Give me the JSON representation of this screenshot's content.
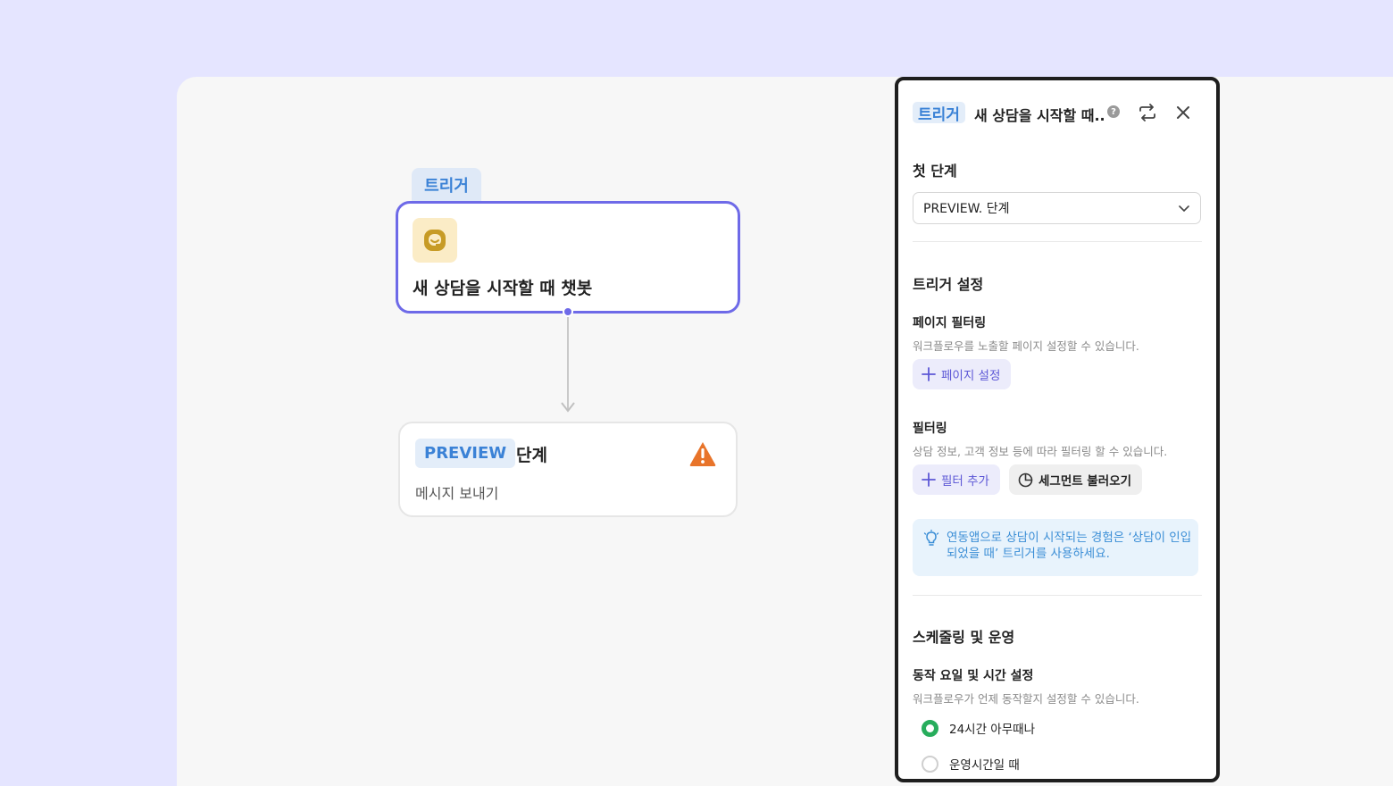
{
  "canvas": {
    "trigger_tag": "트리거",
    "trigger_card": {
      "title": "새 상담을 시작할 때 챗봇",
      "icon": "chat-bubble-icon"
    },
    "step_card": {
      "badge": "PREVIEW",
      "title": "단계",
      "subtitle": "메시지 보내기",
      "status_icon": "warning-icon"
    }
  },
  "panel": {
    "header": {
      "tag": "트리거",
      "title": "새 상담을 시작할 때...",
      "help_icon": "?"
    },
    "first_step": {
      "title": "첫 단계",
      "select_value": "PREVIEW. 단계"
    },
    "trigger_settings": {
      "title": "트리거 설정",
      "page_filtering": {
        "title": "페이지 필터링",
        "help": "워크플로우를 노출할 페이지 설정할 수 있습니다.",
        "button": "페이지 설정"
      },
      "filtering": {
        "title": "필터링",
        "help": "상담 정보, 고객 정보 등에 따라 필터링 할 수 있습니다.",
        "add_button": "필터 추가",
        "segment_button": "세그먼트 불러오기"
      },
      "info": "연동앱으로 상담이 시작되는 경험은 ‘상담이 인입되었을 때’ 트리거를 사용하세요."
    },
    "scheduling": {
      "title": "스케줄링 및 운영",
      "schedule": {
        "title": "동작 요일 및 시간 설정",
        "help": "워크플로우가 언제 동작할지 설정할 수 있습니다.",
        "options": [
          {
            "label": "24시간 아무때나",
            "selected": true
          },
          {
            "label": "운영시간일 때",
            "selected": false
          }
        ]
      }
    }
  },
  "colors": {
    "accent": "#6e6ae8",
    "tag_blue": "#3b82d6",
    "warning": "#e8742a",
    "radio_on": "#27ad5c",
    "background": "#e5e5ff"
  }
}
